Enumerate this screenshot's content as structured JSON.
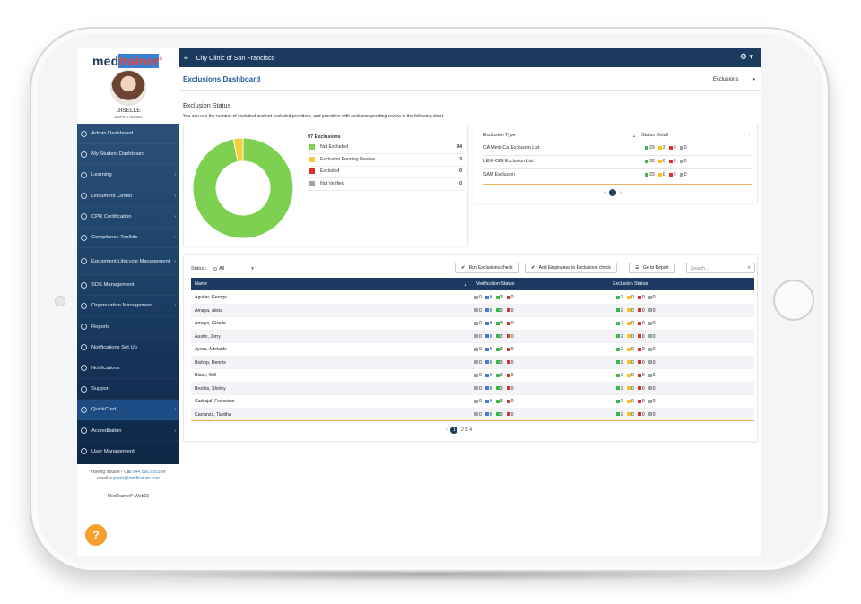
{
  "sidebar": {
    "logo": {
      "part1": "med",
      "part2": "trainer",
      "mark": "®"
    },
    "user": {
      "name": "GISELLE",
      "role": "SUPER ADMIN"
    },
    "items": [
      {
        "label": "Admin Dashboard",
        "icon": "dashboard-icon",
        "arrow": ""
      },
      {
        "label": "My Student Dashboard",
        "icon": "graduation-cap-icon",
        "arrow": ""
      },
      {
        "label": "Learning",
        "icon": "book-icon",
        "arrow": "›"
      },
      {
        "label": "Document Center",
        "icon": "document-icon",
        "arrow": "›"
      },
      {
        "label": "CPR Certification",
        "icon": "heart-icon",
        "arrow": "›"
      },
      {
        "label": "Compliance Toolkits",
        "icon": "wrench-icon",
        "arrow": "›"
      },
      {
        "label": "Equipment Lifecycle Management",
        "icon": "equipment-icon",
        "arrow": "›"
      },
      {
        "label": "SDS Management",
        "icon": "warning-icon",
        "arrow": ""
      },
      {
        "label": "Organization Management",
        "icon": "building-icon",
        "arrow": "›"
      },
      {
        "label": "Reports",
        "icon": "reports-icon",
        "arrow": ""
      },
      {
        "label": "Notifications Set Up",
        "icon": "settings-icon",
        "arrow": ""
      },
      {
        "label": "Notifications",
        "icon": "bell-icon",
        "arrow": ""
      },
      {
        "label": "Support",
        "icon": "headset-icon",
        "arrow": ""
      },
      {
        "label": "QuickCred",
        "icon": "id-card-icon",
        "arrow": "›"
      },
      {
        "label": "Accreditation",
        "icon": "certificate-icon",
        "arrow": "›"
      },
      {
        "label": "User Management",
        "icon": "users-icon",
        "arrow": ""
      }
    ],
    "help_text": "Having trouble? Call",
    "help_phone": "844.596.6553",
    "help_or": "or",
    "help_email_prefix": "email",
    "help_email": "support@medtrainer.com",
    "version": "MedTrainerP-Web03",
    "help_button": "?"
  },
  "topbar": {
    "menu_icon": "≡",
    "title": "City Clinic of San Francisco",
    "settings_icon": "⚙ ▾"
  },
  "header": {
    "title": "Exclusions Dashboard",
    "select_value": "Exclusions",
    "select_caret": "▾"
  },
  "exclusion_status": {
    "title": "Exclusion Status",
    "description": "You can see the number of excluded and not excluded providers, and providers with exclusion pending review in the following chart."
  },
  "chart_data": {
    "type": "pie",
    "title": "97 Exclusions",
    "categories": [
      "Not Excluded",
      "Exclusion Pending Review",
      "Excluded",
      "Not Verified"
    ],
    "values": [
      94,
      3,
      0,
      0
    ],
    "colors": [
      "#7ed150",
      "#f5cc3a",
      "#d9342b",
      "#9ea3a8"
    ]
  },
  "exclusion_types": {
    "headers": {
      "type": "Exclusion Type",
      "sort": "▲",
      "detail": "Status Detail",
      "more": "↕"
    },
    "rows": [
      {
        "name": "CA Medi-Cal Exclusion List",
        "g": "29",
        "y": "3",
        "r": "0",
        "gr": "0"
      },
      {
        "name": "LEIE-OIG Exclusion List",
        "g": "32",
        "y": "0",
        "r": "0",
        "gr": "0"
      },
      {
        "name": "SAM Exclusion",
        "g": "33",
        "y": "0",
        "r": "0",
        "gr": "0"
      }
    ],
    "pager": {
      "prev": "‹",
      "current": "1",
      "next": "›"
    }
  },
  "employees": {
    "filter_label": "Status:",
    "filter_value": "All",
    "filter_caret": "▾",
    "buttons": {
      "run": "Run Exclusions check",
      "add": "Add Employees to Exclusions check",
      "report": "Go to Report",
      "check_icon": "✔",
      "report_icon": "☰"
    },
    "search_placeholder": "Search...",
    "search_icon": "⌕",
    "headers": {
      "name": "Name",
      "sort": "▲",
      "verification": "Verification Status",
      "exclusion": "Exclusion Status"
    },
    "rows": [
      {
        "name": "Aguilar, George",
        "v": [
          "0",
          "0",
          "3",
          "0"
        ],
        "e": [
          "3",
          "0",
          "0",
          "0"
        ]
      },
      {
        "name": "Amaya, alexa",
        "v": [
          "0",
          "0",
          "3",
          "0"
        ],
        "e": [
          "3",
          "0",
          "0",
          "0"
        ]
      },
      {
        "name": "Amaya, Giselle",
        "v": [
          "0",
          "0",
          "3",
          "0"
        ],
        "e": [
          "3",
          "0",
          "0",
          "0"
        ]
      },
      {
        "name": "Austin, Jerry",
        "v": [
          "0",
          "0",
          "3",
          "0"
        ],
        "e": [
          "3",
          "0",
          "0",
          "0"
        ]
      },
      {
        "name": "Ayres, Adelaide",
        "v": [
          "0",
          "0",
          "3",
          "0"
        ],
        "e": [
          "3",
          "0",
          "0",
          "0"
        ]
      },
      {
        "name": "Bishop, Dennis",
        "v": [
          "0",
          "0",
          "3",
          "0"
        ],
        "e": [
          "3",
          "0",
          "0",
          "0"
        ]
      },
      {
        "name": "Black, Will",
        "v": [
          "0",
          "0",
          "3",
          "0"
        ],
        "e": [
          "3",
          "0",
          "0",
          "0"
        ]
      },
      {
        "name": "Brooks, Shirley",
        "v": [
          "0",
          "0",
          "3",
          "0"
        ],
        "e": [
          "3",
          "0",
          "0",
          "0"
        ]
      },
      {
        "name": "Carbajal, Francisco",
        "v": [
          "0",
          "0",
          "3",
          "0"
        ],
        "e": [
          "3",
          "0",
          "0",
          "0"
        ]
      },
      {
        "name": "Carranza, Tabitha",
        "v": [
          "0",
          "0",
          "3",
          "0"
        ],
        "e": [
          "3",
          "0",
          "0",
          "0"
        ]
      }
    ],
    "pager": {
      "prev": "‹",
      "current": "1",
      "p2": "2",
      "p3": "3",
      "p4": "4",
      "next": "›"
    }
  }
}
